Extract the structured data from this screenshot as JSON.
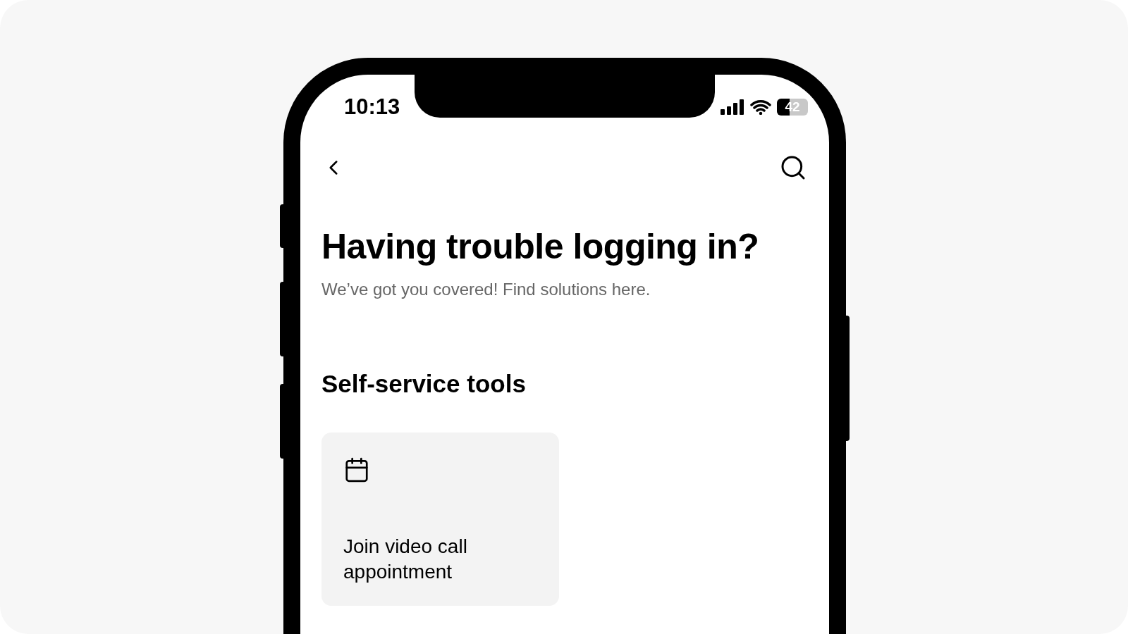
{
  "status_bar": {
    "time": "10:13",
    "battery": "42"
  },
  "header": {
    "title": "Having trouble logging in?",
    "subtitle": "We’ve got you covered! Find solutions here."
  },
  "section": {
    "title": "Self-service tools",
    "cards": [
      {
        "label": "Join video call appointment"
      }
    ]
  }
}
